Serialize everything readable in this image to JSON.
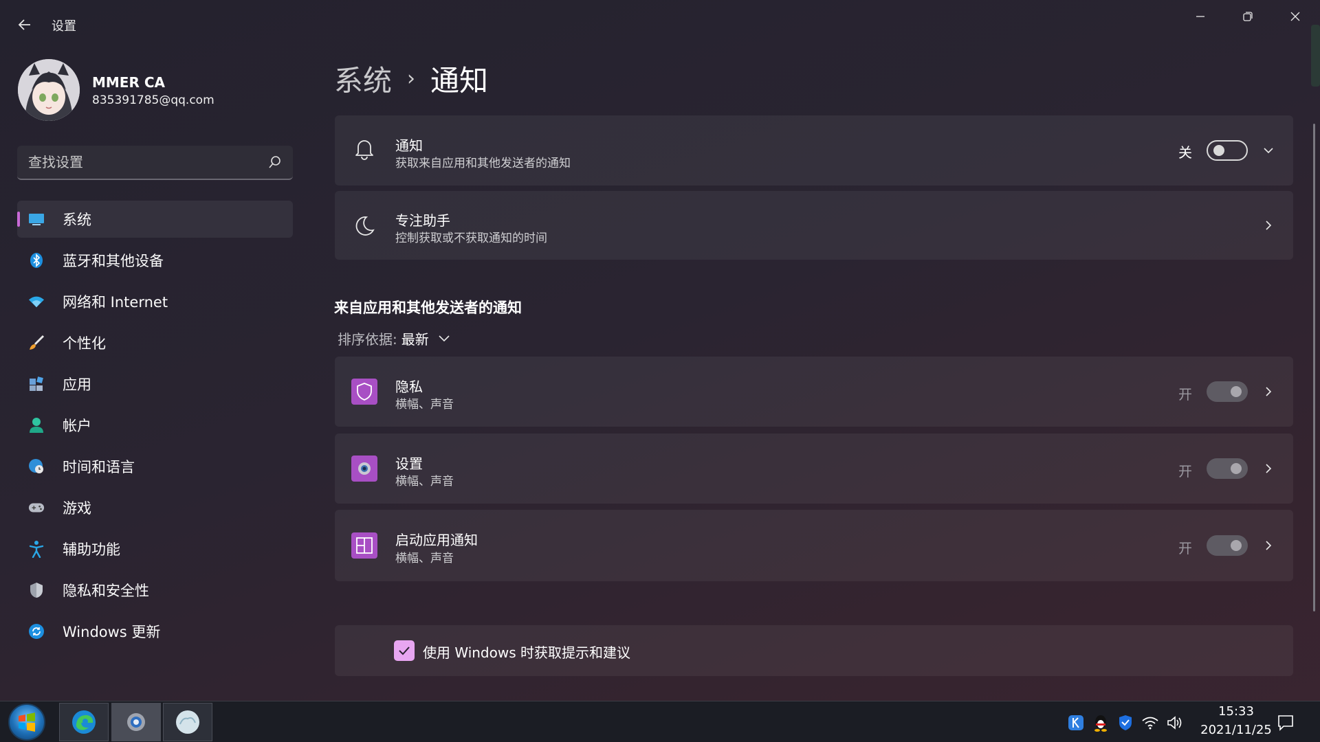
{
  "window": {
    "title": "设置",
    "controls": [
      "minimize",
      "restore",
      "close"
    ]
  },
  "user": {
    "name": "MMER CA",
    "email": "835391785@qq.com"
  },
  "search": {
    "placeholder": "查找设置"
  },
  "sidebar": {
    "items": [
      {
        "label": "系统",
        "icon": "system-icon",
        "active": true
      },
      {
        "label": "蓝牙和其他设备",
        "icon": "bluetooth-icon"
      },
      {
        "label": "网络和 Internet",
        "icon": "wifi-icon"
      },
      {
        "label": "个性化",
        "icon": "brush-icon"
      },
      {
        "label": "应用",
        "icon": "apps-icon"
      },
      {
        "label": "帐户",
        "icon": "account-icon"
      },
      {
        "label": "时间和语言",
        "icon": "globe-clock-icon"
      },
      {
        "label": "游戏",
        "icon": "gamepad-icon"
      },
      {
        "label": "辅助功能",
        "icon": "accessibility-icon"
      },
      {
        "label": "隐私和安全性",
        "icon": "shield-icon"
      },
      {
        "label": "Windows 更新",
        "icon": "update-icon"
      }
    ]
  },
  "breadcrumb": {
    "parent": "系统",
    "separator": "›",
    "current": "通知"
  },
  "notifications_card": {
    "title": "通知",
    "subtitle": "获取来自应用和其他发送者的通知",
    "state_label": "关",
    "toggle_on": false
  },
  "focus_card": {
    "title": "专注助手",
    "subtitle": "控制获取或不获取通知的时间"
  },
  "apps_section": {
    "heading": "来自应用和其他发送者的通知",
    "sort_label": "排序依据:",
    "sort_value": "最新",
    "apps": [
      {
        "title": "隐私",
        "subtitle": "横幅、声音",
        "state_label": "开",
        "toggle_on": true,
        "icon": "privacy-shield-icon"
      },
      {
        "title": "设置",
        "subtitle": "横幅、声音",
        "state_label": "开",
        "toggle_on": true,
        "icon": "settings-gear-icon"
      },
      {
        "title": "启动应用通知",
        "subtitle": "横幅、声音",
        "state_label": "开",
        "toggle_on": true,
        "icon": "startup-apps-icon"
      }
    ]
  },
  "tips": {
    "label": "使用 Windows 时获取提示和建议",
    "checked": true
  },
  "taskbar": {
    "time": "15:33",
    "date": "2021/11/25",
    "pinned": [
      "start-orb-icon",
      "edge-icon",
      "settings-icon",
      "weather-app-icon"
    ],
    "tray": [
      "k-app-icon",
      "qq-penguin-icon",
      "security-shield-icon",
      "wifi-icon",
      "volume-icon",
      "action-center-icon"
    ]
  },
  "colors": {
    "accent": "#c869d6",
    "app_icon_bg": "#a84fc4",
    "checkbox": "#e8a6f1"
  }
}
